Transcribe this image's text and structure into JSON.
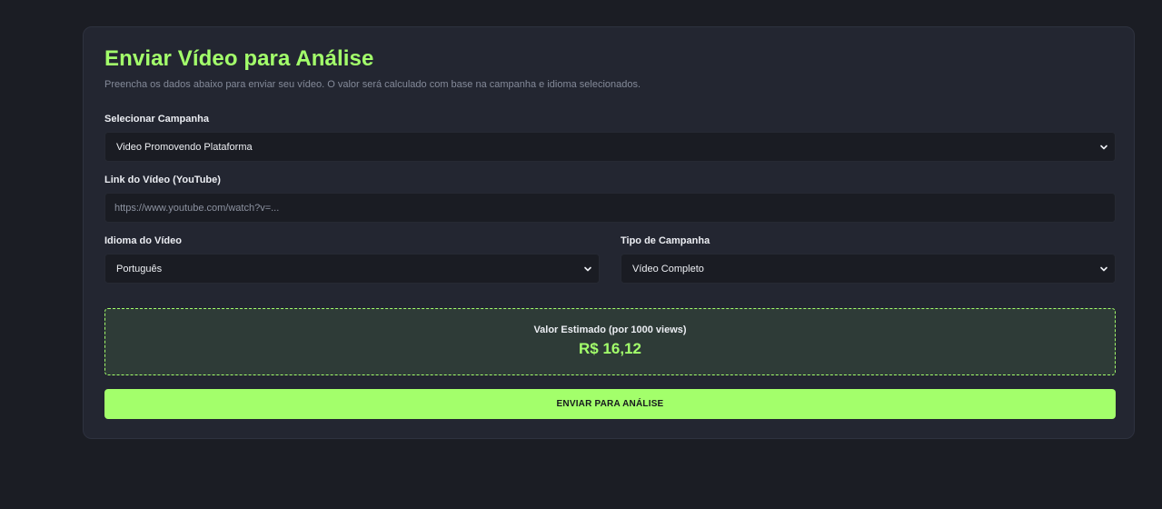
{
  "form": {
    "title": "Enviar Vídeo para Análise",
    "subtitle": "Preencha os dados abaixo para enviar seu vídeo. O valor será calculado com base na campanha e idioma selecionados.",
    "campaign": {
      "label": "Selecionar Campanha",
      "value": "Video Promovendo Plataforma",
      "icon": "chevron-down-icon"
    },
    "video_link": {
      "label": "Link do Vídeo (YouTube)",
      "value": "",
      "placeholder": "https://www.youtube.com/watch?v=..."
    },
    "language": {
      "label": "Idioma do Vídeo",
      "value": "Português",
      "icon": "chevron-down-icon"
    },
    "campaign_type": {
      "label": "Tipo de Campanha",
      "value": "Vídeo Completo",
      "icon": "chevron-down-icon"
    },
    "estimate": {
      "label": "Valor Estimado (por 1000 views)",
      "value": "R$ 16,12"
    },
    "submit_label": "ENVIAR PARA ANÁLISE"
  },
  "colors": {
    "background": "#1b1d24",
    "card": "#232631",
    "field": "#1a1c23",
    "accent": "#a3ff6b",
    "estimate_bg": "#2e3b37"
  }
}
